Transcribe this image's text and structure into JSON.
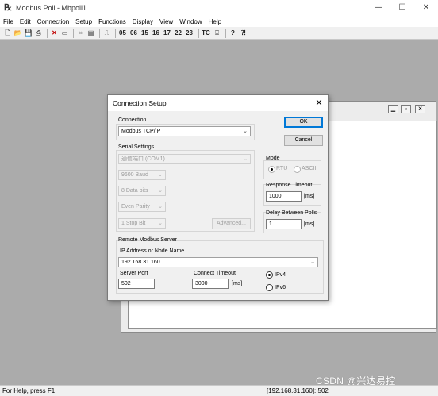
{
  "window": {
    "title": "Modbus Poll - Mbpoll1",
    "icon": "modbus-poll-app-icon",
    "controls": [
      "—",
      "☐",
      "✕"
    ]
  },
  "menu": [
    "File",
    "Edit",
    "Connection",
    "Setup",
    "Functions",
    "Display",
    "View",
    "Window",
    "Help"
  ],
  "toolbar": {
    "function_codes": [
      "05",
      "06",
      "15",
      "16",
      "17",
      "22",
      "23"
    ],
    "tc_label": "TC"
  },
  "child_window": {
    "controls": [
      "▁",
      "▫",
      "✕"
    ]
  },
  "dialog": {
    "title": "Connection Setup",
    "connection": {
      "label": "Connection",
      "value": "Modbus TCP/IP"
    },
    "serial": {
      "label": "Serial Settings",
      "port": "通信端口 (COM1)",
      "baud": "9600 Baud",
      "data_bits": "8 Data bits",
      "parity": "Even Parity",
      "stop_bits": "1 Stop Bit",
      "advanced": "Advanced..."
    },
    "buttons": {
      "ok": "OK",
      "cancel": "Cancel"
    },
    "mode": {
      "label": "Mode",
      "rtu": "RTU",
      "ascii": "ASCII",
      "selected": "RTU"
    },
    "response_timeout": {
      "label": "Response Timeout",
      "value": "1000",
      "unit": "[ms]"
    },
    "delay_between_polls": {
      "label": "Delay Between Polls",
      "value": "1",
      "unit": "[ms]"
    },
    "remote": {
      "label": "Remote Modbus Server",
      "ip_label": "IP Address or Node Name",
      "ip_value": "192.168.31.160",
      "port_label": "Server Port",
      "port_value": "502",
      "timeout_label": "Connect Timeout",
      "timeout_value": "3000",
      "timeout_unit": "[ms]",
      "ipv4": "IPv4",
      "ipv6": "IPv6",
      "selected_ip_version": "IPv4"
    }
  },
  "status": {
    "help": "For Help, press F1.",
    "connection": "[192.168.31.160]: 502"
  },
  "watermark": "CSDN @兴达易控"
}
